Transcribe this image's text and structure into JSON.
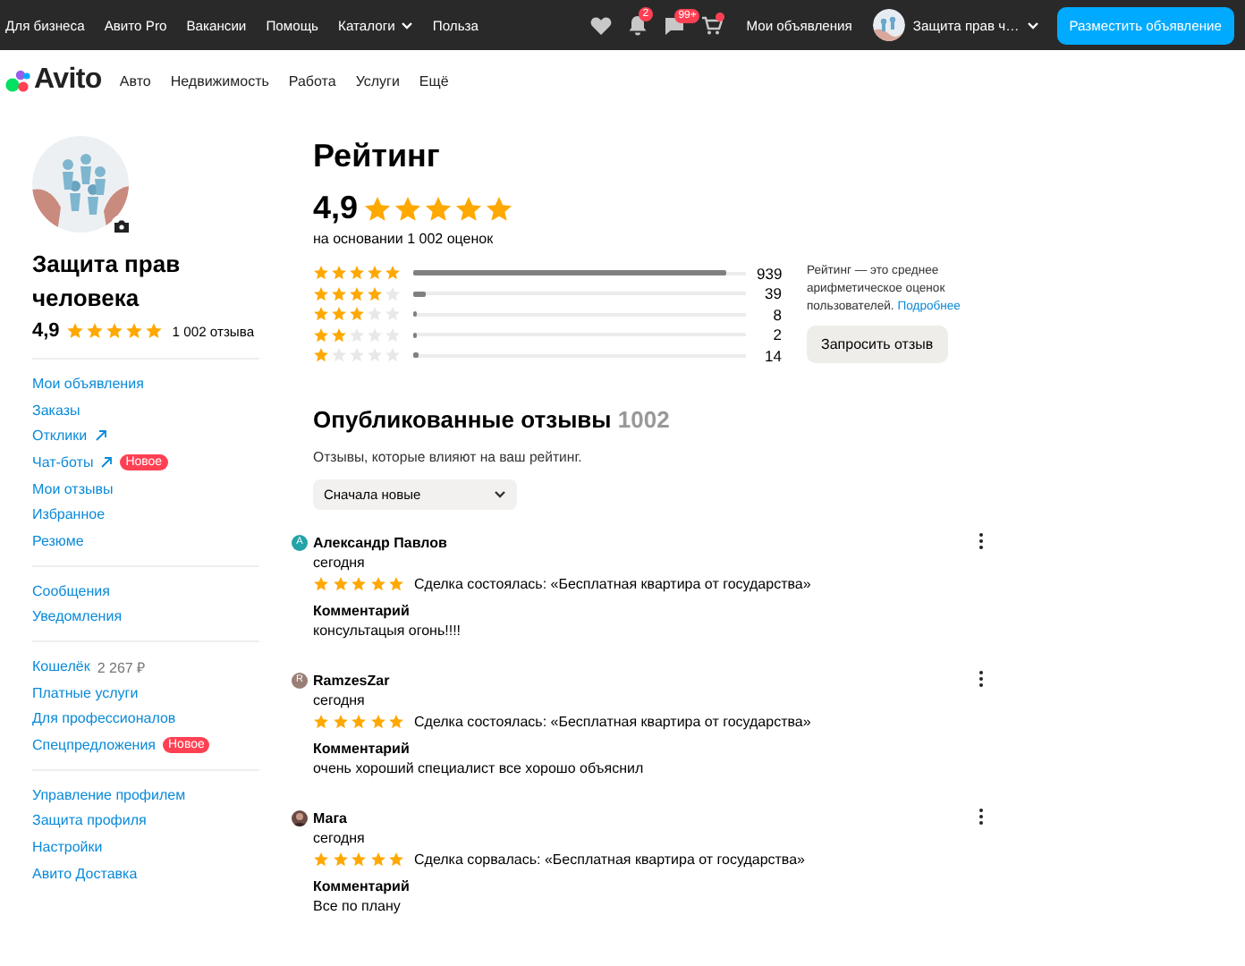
{
  "topbar": {
    "links": [
      {
        "label": "Для бизнеса",
        "dropdown": false
      },
      {
        "label": "Авито Pro",
        "dropdown": false
      },
      {
        "label": "Вакансии",
        "dropdown": false
      },
      {
        "label": "Помощь",
        "dropdown": false
      },
      {
        "label": "Каталоги",
        "dropdown": true
      },
      {
        "label": "Польза",
        "dropdown": false
      }
    ],
    "notifications_badge": "2",
    "messages_badge": "99+",
    "cart_dot": true,
    "my_ads": "Мои объявления",
    "user_name": "Защита прав ч…",
    "post_button": "Разместить объявление"
  },
  "navbar": {
    "logo": "Avito",
    "links": [
      "Авто",
      "Недвижимость",
      "Работа",
      "Услуги",
      "Ещё"
    ]
  },
  "sidebar": {
    "profile": {
      "name": "Защита прав человека",
      "score": "4,9",
      "stars": 5,
      "reviews": "1 002 отзыва"
    },
    "groups": [
      [
        {
          "label": "Мои объявления",
          "external": false
        },
        {
          "label": "Заказы",
          "external": false
        },
        {
          "label": "Отклики",
          "external": true
        },
        {
          "label": "Чат-боты",
          "external": true,
          "badge": "Новое"
        },
        {
          "label": "Мои отзывы",
          "external": false
        },
        {
          "label": "Избранное",
          "external": false
        },
        {
          "label": "Резюме",
          "external": false
        }
      ],
      [
        {
          "label": "Сообщения",
          "external": false
        },
        {
          "label": "Уведомления",
          "external": false
        }
      ],
      [
        {
          "label": "Кошелёк",
          "external": false,
          "value": "2 267 ₽"
        },
        {
          "label": "Платные услуги",
          "external": false
        },
        {
          "label": "Для профессионалов",
          "external": false
        },
        {
          "label": "Спецпредложения",
          "external": false,
          "badge": "Новое"
        }
      ],
      [
        {
          "label": "Управление профилем",
          "external": false
        },
        {
          "label": "Защита профиля",
          "external": false
        },
        {
          "label": "Настройки",
          "external": false
        },
        {
          "label": "Авито Доставка",
          "external": false
        }
      ]
    ]
  },
  "rating": {
    "title": "Рейтинг",
    "score": "4,9",
    "stars": 5,
    "basis": "на основании 1 002 оценок",
    "bars": [
      {
        "stars": 5,
        "level": 0.94,
        "count": "939"
      },
      {
        "stars": 4,
        "level": 0.04,
        "count": "39"
      },
      {
        "stars": 3,
        "level": 0.008,
        "count": "8"
      },
      {
        "stars": 2,
        "level": 0.002,
        "count": "2"
      },
      {
        "stars": 1,
        "level": 0.014,
        "count": "14"
      }
    ],
    "note": "Рейтинг — это среднее арифметическое оценок пользователей.",
    "note_link": "Подробнее",
    "request_button": "Запросить отзыв"
  },
  "reviews": {
    "title": "Опубликованные отзывы",
    "count": "1002",
    "subtitle": "Отзывы, которые влияют на ваш рейтинг.",
    "sort": "Сначала новые",
    "items": [
      {
        "author": "Александр Павлов",
        "avatar": {
          "kind": "letter",
          "letter": "А",
          "color": "#23a3a8"
        },
        "date": "сегодня",
        "stars": 5,
        "deal": "Сделка состоялась: «Бесплатная квартира от государства»",
        "comment_label": "Комментарий",
        "comment": "консультацыя огонь!!!!"
      },
      {
        "author": "RamzesZar",
        "avatar": {
          "kind": "letter",
          "letter": "R",
          "color": "#9a7f77"
        },
        "date": "сегодня",
        "stars": 5,
        "deal": "Сделка состоялась: «Бесплатная квартира от государства»",
        "comment_label": "Комментарий",
        "comment": "очень хороший специалист все хорошо объяснил"
      },
      {
        "author": "Мага",
        "date": "сегодня",
        "stars": 5,
        "deal": "Сделка сорвалась: «Бесплатная квартира от государства»",
        "comment_label": "Комментарий",
        "comment": "Все по плану"
      }
    ]
  }
}
